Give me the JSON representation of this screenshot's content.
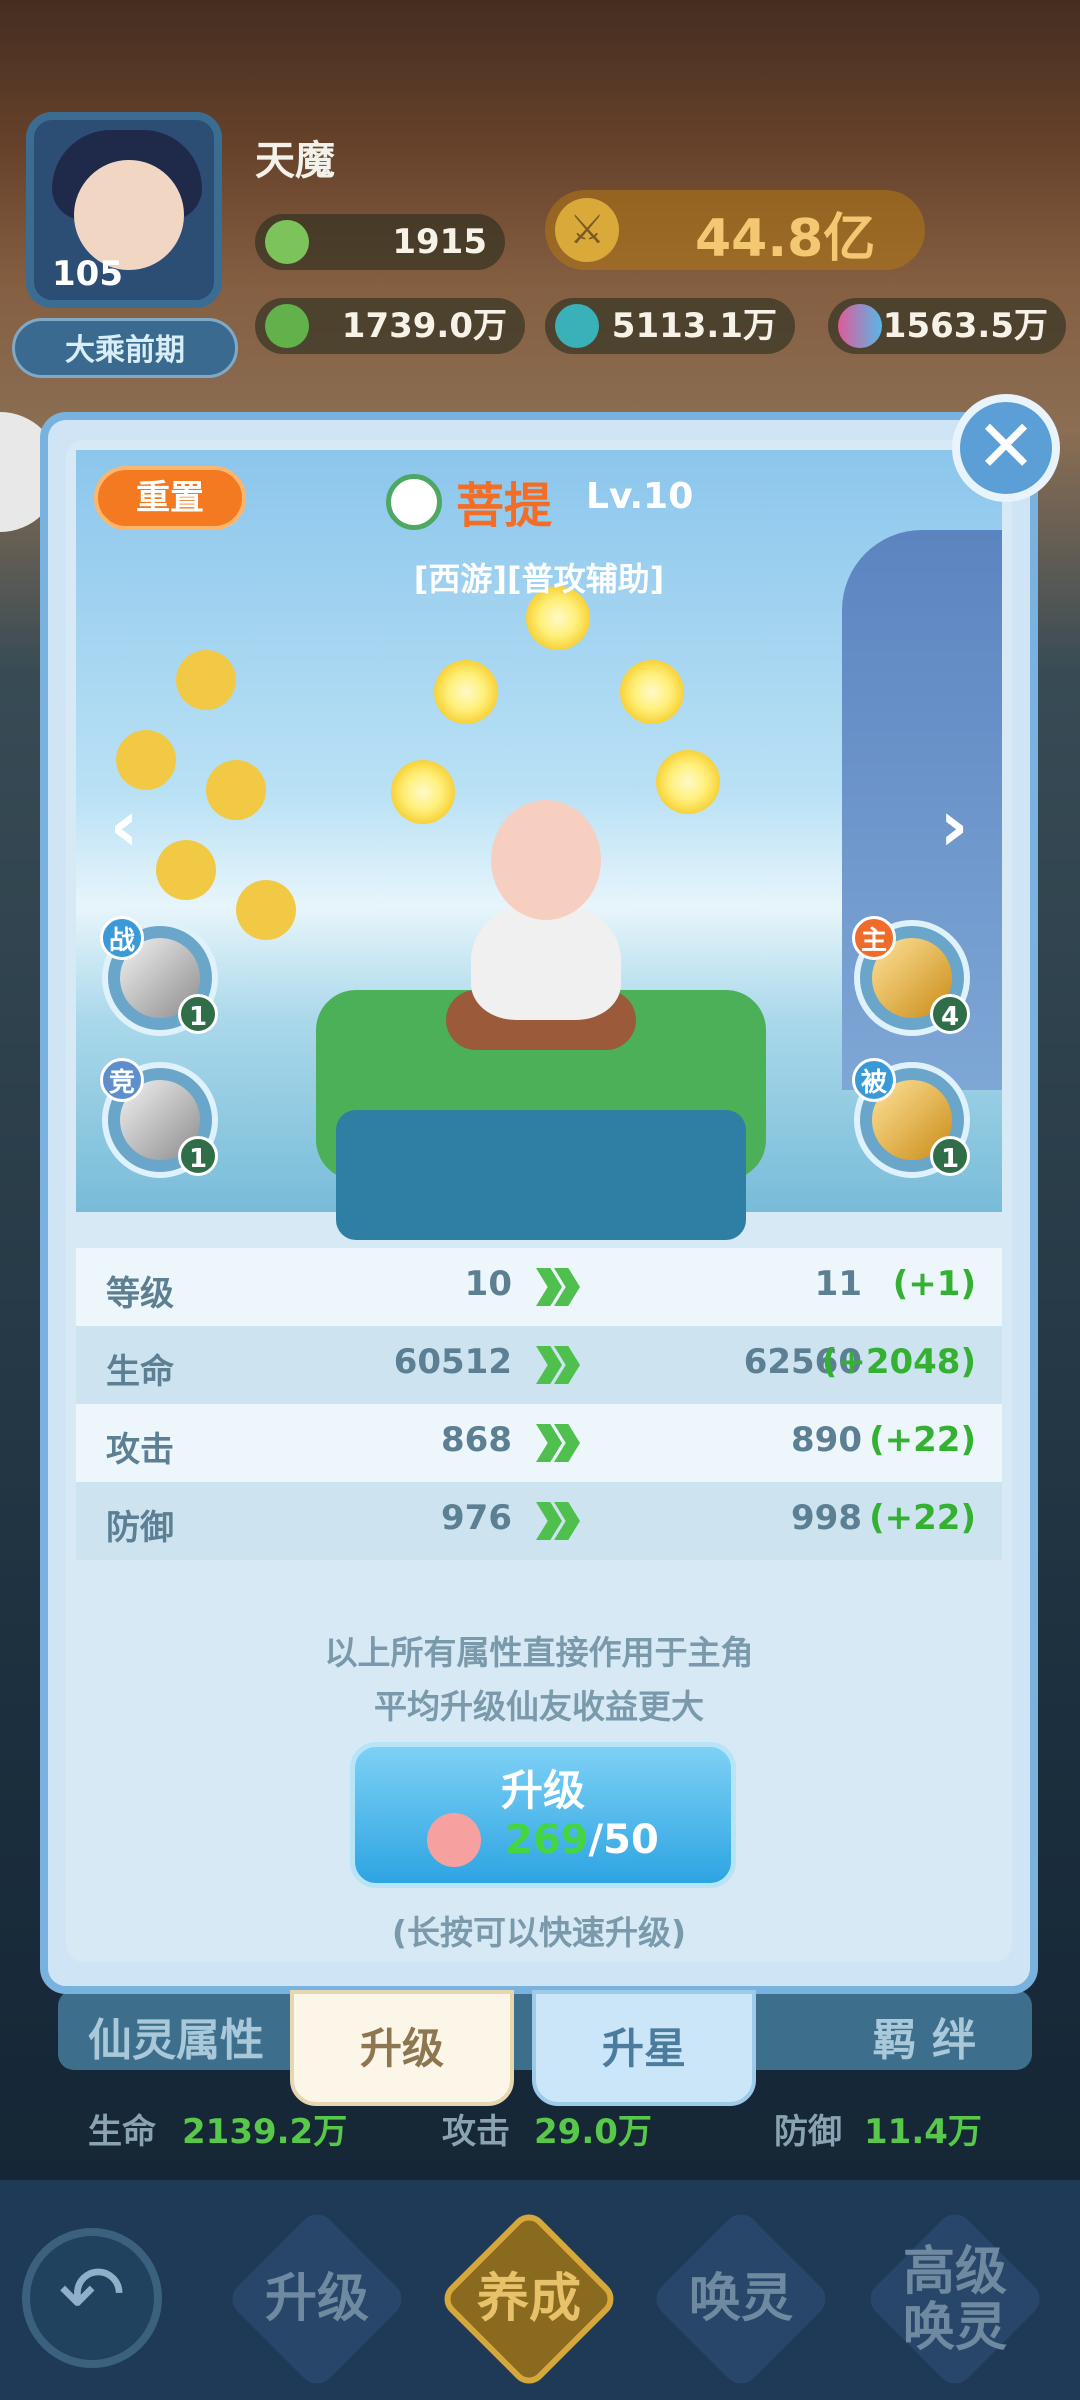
{
  "player": {
    "name": "天魔",
    "level": "105",
    "realm": "大乘前期",
    "peach": "1915",
    "power": "44.8亿",
    "res1": "1739.0万",
    "res2": "5113.1万",
    "res3": "1563.5万"
  },
  "panel": {
    "reset_label": "重置",
    "hero_name": "菩提",
    "hero_level": "Lv.10",
    "tags": "[西游][普攻辅助]",
    "skills": {
      "battle": {
        "tag": "战",
        "count": "1"
      },
      "arena": {
        "tag": "竞",
        "count": "1"
      },
      "active": {
        "tag": "主",
        "count": "4"
      },
      "passive": {
        "tag": "被",
        "count": "1"
      }
    },
    "stats": [
      {
        "label": "等级",
        "current": "10",
        "next": "11",
        "diff": "(+1)"
      },
      {
        "label": "生命",
        "current": "60512",
        "next": "62560",
        "diff": "(+2048)"
      },
      {
        "label": "攻击",
        "current": "868",
        "next": "890",
        "diff": "(+22)"
      },
      {
        "label": "防御",
        "current": "976",
        "next": "998",
        "diff": "(+22)"
      }
    ],
    "info1": "以上所有属性直接作用于主角",
    "info2": "平均升级仙友收益更大",
    "upgrade": {
      "label": "升级",
      "have": "269",
      "need": "/50"
    },
    "hint": "(长按可以快速升级)"
  },
  "lower": {
    "left_title": "仙灵属性",
    "right_title": "羁 绊",
    "tab_upgrade": "升级",
    "tab_star": "升星",
    "attr_life_label": "生命",
    "attr_life_value": "2139.2万",
    "attr_atk_label": "攻击",
    "attr_atk_value": "29.0万",
    "attr_def_label": "防御",
    "attr_def_value": "11.4万"
  },
  "nav": {
    "upgrade": "升级",
    "cultivate": "养成",
    "summon": "唤灵",
    "adv1": "高级",
    "adv2": "唤灵"
  },
  "colors": {
    "accent_orange": "#f46d25",
    "increase_green": "#34b132",
    "panel_blue": "#7ab2df"
  }
}
